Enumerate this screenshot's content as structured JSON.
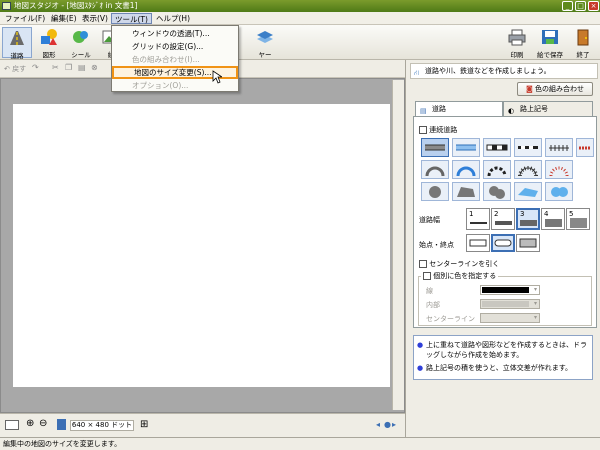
{
  "window": {
    "title": "地図スタジオ - [地図ｽﾀｼﾞｵ in 文書1]",
    "buttons": {
      "minimize": "_",
      "maximize": "□",
      "close": "×"
    }
  },
  "menubar": {
    "items": [
      "ファイル(F)",
      "編集(E)",
      "表示(V)",
      "ツール(T)",
      "ヘルプ(H)"
    ]
  },
  "toolbar": {
    "road": "道路",
    "shape": "図形",
    "seal": "シール",
    "picture": "絵",
    "picture_suffix": "ヤー",
    "print": "印刷",
    "save_as_picture": "絵で保存",
    "exit": "終了"
  },
  "subtoolbar": {
    "undo": "戻す"
  },
  "dropdown": {
    "items": [
      {
        "label": "ウィンドウの透過(T)...",
        "disabled": false
      },
      {
        "label": "グリッドの設定(G)...",
        "disabled": false
      },
      {
        "label": "色の組み合わせ(I)...",
        "disabled": true
      },
      {
        "label": "地図のサイズ変更(S)...",
        "disabled": false,
        "highlighted": true
      },
      {
        "label": "オプション(O)...",
        "disabled": true
      }
    ]
  },
  "bottombar": {
    "size_readout": "640 × 480 ドット"
  },
  "statusbar": {
    "text": "編集中の地図のサイズを変更します。"
  },
  "panel": {
    "hint": "道路や川、鉄道などを作成しましょう。",
    "color_combo_button": "色の組み合わせ",
    "tabs": [
      "道路",
      "路上記号"
    ],
    "continuous_road": "連続道路",
    "road_width_label": "道路幅",
    "road_widths": [
      "1",
      "2",
      "3",
      "4",
      "5"
    ],
    "endpoint_label": "始点・終点",
    "center_line": "センターラインを引く",
    "individual_color_group": "個別に色を指定する",
    "line_label": "線",
    "inner_label": "内部",
    "center_line_label": "センターライン",
    "info": [
      "上に重ねて道路や図形などを作成するときは、ドラッグしながら作成を始めます。",
      "路上記号の積を使うと、立体交差が作れます。"
    ]
  },
  "colors": {
    "title_bar": "#5d8a1e",
    "highlight_border": "#f09316",
    "selection_blue": "#3c6fb4",
    "canvas_gray": "#a8a8a8"
  }
}
